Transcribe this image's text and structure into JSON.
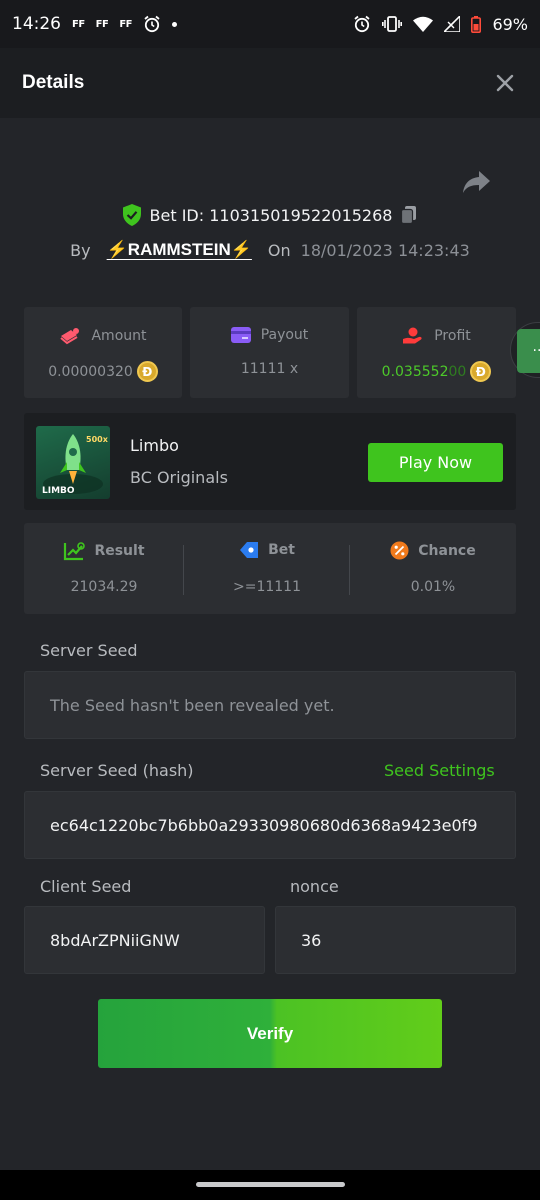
{
  "status_bar": {
    "time": "14:26",
    "notif_ff": [
      "FF",
      "FF",
      "FF"
    ],
    "battery": "69%"
  },
  "header": {
    "title": "Details"
  },
  "bet": {
    "id_label": "Bet ID: 110315019522015268",
    "by_label": "By",
    "username": "⚡RAMMSTEIN⚡",
    "on_label": "On",
    "date": "18/01/2023 14:23:43"
  },
  "stats": {
    "amount": {
      "label": "Amount",
      "value": "0.00000320"
    },
    "payout": {
      "label": "Payout",
      "value": "11111 x"
    },
    "profit": {
      "label": "Profit",
      "value_main": "0.035552",
      "value_tail": "00"
    },
    "coin_symbol": "Ð"
  },
  "game": {
    "name": "Limbo",
    "provider": "BC Originals",
    "play_label": "Play Now",
    "thumb_badge": "500x",
    "thumb_label": "LIMBO"
  },
  "result": {
    "result": {
      "label": "Result",
      "value": "21034.29"
    },
    "bet": {
      "label": "Bet",
      "value": ">=11111"
    },
    "chance": {
      "label": "Chance",
      "value": "0.01%"
    }
  },
  "seeds": {
    "server_seed_label": "Server Seed",
    "server_seed_value": "The Seed hasn't been revealed yet.",
    "server_hash_label": "Server Seed (hash)",
    "seed_settings_label": "Seed Settings",
    "server_hash_value": "ec64c1220bc7b6bb0a29330980680d6368a9423e0f9",
    "client_seed_label": "Client Seed",
    "client_seed_value": "8bdArZPNiiGNW",
    "nonce_label": "nonce",
    "nonce_value": "36"
  },
  "verify_label": "Verify",
  "colors": {
    "accent_green": "#3fc41e",
    "profit_green": "#4dc92a",
    "background": "#232529",
    "card": "#2c2e32"
  }
}
